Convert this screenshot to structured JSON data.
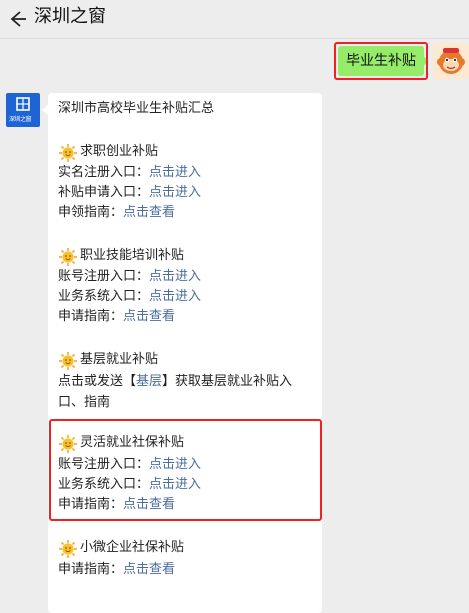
{
  "header": {
    "title": "深圳之窗"
  },
  "sent_message": {
    "text": "毕业生补贴"
  },
  "bot": {
    "logo_text": "深圳之窗"
  },
  "message": {
    "heading": "深圳市高校毕业生补贴汇总",
    "sections": [
      {
        "title": "求职创业补贴",
        "lines": [
          {
            "label": "实名注册入口：",
            "link": "点击进入"
          },
          {
            "label": "补贴申请入口：",
            "link": "点击进入"
          },
          {
            "label": "申领指南：",
            "link": "点击查看"
          }
        ]
      },
      {
        "title": "职业技能培训补贴",
        "lines": [
          {
            "label": "账号注册入口：",
            "link": "点击进入"
          },
          {
            "label": "业务系统入口：",
            "link": "点击进入"
          },
          {
            "label": "申请指南：",
            "link": "点击查看"
          }
        ]
      },
      {
        "title": "基层就业补贴",
        "text_prefix": "点击或发送【",
        "keyword": "基层",
        "text_suffix": "】获取基层就业补贴入",
        "text_line2": "口、指南"
      },
      {
        "title": "灵活就业社保补贴",
        "lines": [
          {
            "label": "账号注册入口：",
            "link": "点击进入"
          },
          {
            "label": "业务系统入口：",
            "link": "点击进入"
          },
          {
            "label": "申请指南：",
            "link": "点击查看"
          }
        ]
      },
      {
        "title": "小微企业社保补贴",
        "lines": [
          {
            "label": "申请指南：",
            "link": "点击查看"
          }
        ]
      }
    ]
  },
  "colors": {
    "link": "#4a6d9c",
    "sent_bubble": "#95ec69",
    "highlight": "#ee2222",
    "bot_avatar": "#1f64d4"
  },
  "icons": {
    "section": "sun-emoji-icon",
    "back": "back-arrow-icon"
  }
}
